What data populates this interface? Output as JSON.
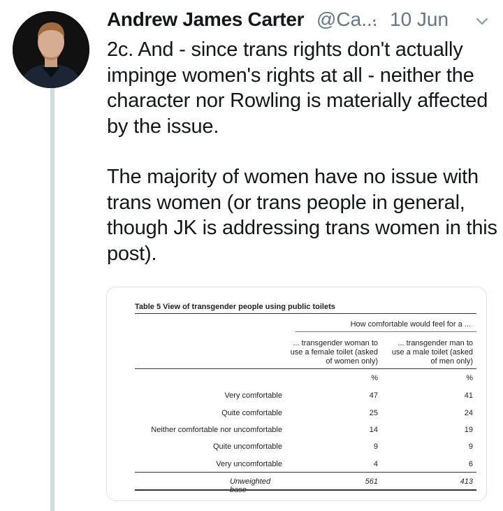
{
  "tweet": {
    "author_name": "Andrew James Carter",
    "handle": "@Ca...",
    "separator": "·",
    "date": "10 Jun",
    "paragraphs": [
      "2c. And - since trans rights don't actually impinge women's rights at all - neither the character nor Rowling is materially affected by the issue.",
      "The majority of women have no issue with trans women (or trans people in general, though JK is addressing trans women in this post)."
    ],
    "icons": {
      "avatar": "user-avatar",
      "more": "chevron-down-icon"
    }
  },
  "table": {
    "title": "Table 5 View of transgender people using public toilets",
    "heading": "How comfortable would feel for a ...",
    "columns": [
      "... transgender woman to use a female toilet (asked of women only)",
      "... transgender man to use a male toilet (asked of men only)"
    ],
    "unit": [
      "%",
      "%"
    ],
    "rows": [
      {
        "label": "Very comfortable",
        "values": [
          "47",
          "41"
        ]
      },
      {
        "label": "Quite comfortable",
        "values": [
          "25",
          "24"
        ]
      },
      {
        "label": "Neither comfortable nor uncomfortable",
        "values": [
          "14",
          "19"
        ]
      },
      {
        "label": "Quite uncomfortable",
        "values": [
          "9",
          "9"
        ]
      },
      {
        "label": "Very uncomfortable",
        "values": [
          "4",
          "6"
        ]
      }
    ],
    "base": {
      "label": "Unweighted base",
      "values": [
        "561",
        "413"
      ]
    }
  },
  "colors": {
    "thread_line": "#cfd9de",
    "secondary_text": "#657786",
    "primary_text": "#14171a"
  }
}
